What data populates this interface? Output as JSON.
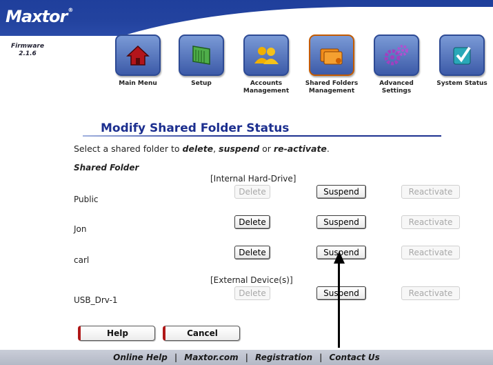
{
  "brand": {
    "logo": "Maxtor",
    "tm": "®"
  },
  "firmware": {
    "label": "Firmware",
    "version": "2.1.6"
  },
  "nav": [
    {
      "id": "main-menu",
      "label": "Main Menu",
      "icon": "house-icon"
    },
    {
      "id": "setup",
      "label": "Setup",
      "icon": "drive-icon"
    },
    {
      "id": "accounts",
      "label": "Accounts Management",
      "icon": "users-icon"
    },
    {
      "id": "shared-folders",
      "label": "Shared Folders Management",
      "icon": "folders-icon"
    },
    {
      "id": "advanced",
      "label": "Advanced Settings",
      "icon": "gears-icon"
    },
    {
      "id": "system-status",
      "label": "System Status",
      "icon": "checkmark-icon"
    }
  ],
  "page": {
    "title": "Modify Shared Folder Status",
    "instructions_prefix": "Select a shared folder to ",
    "delete_word": "delete",
    "comma": ", ",
    "suspend_word": "suspend",
    "or": " or ",
    "reactivate_word": "re-activate",
    "period": ".",
    "column_header": "Shared Folder"
  },
  "groups": {
    "internal": "[Internal Hard-Drive]",
    "external": "[External Device(s)]"
  },
  "folders": [
    {
      "name": "Public",
      "delete_enabled": false,
      "suspend_enabled": true,
      "reactivate_enabled": false
    },
    {
      "name": "Jon",
      "delete_enabled": true,
      "suspend_enabled": true,
      "reactivate_enabled": false
    },
    {
      "name": "carl",
      "delete_enabled": true,
      "suspend_enabled": true,
      "reactivate_enabled": false
    },
    {
      "name": "USB_Drv-1",
      "delete_enabled": false,
      "suspend_enabled": true,
      "reactivate_enabled": false
    }
  ],
  "buttons": {
    "delete": "Delete",
    "suspend": "Suspend",
    "reactivate": "Reactivate",
    "help": "Help",
    "cancel": "Cancel"
  },
  "footer": {
    "links": [
      "Online Help",
      "Maxtor.com",
      "Registration",
      "Contact Us"
    ],
    "separator": "|"
  },
  "colors": {
    "header_blue": "#23439f",
    "title_blue": "#1c2f8f",
    "cancel_accent": "#b01818"
  }
}
